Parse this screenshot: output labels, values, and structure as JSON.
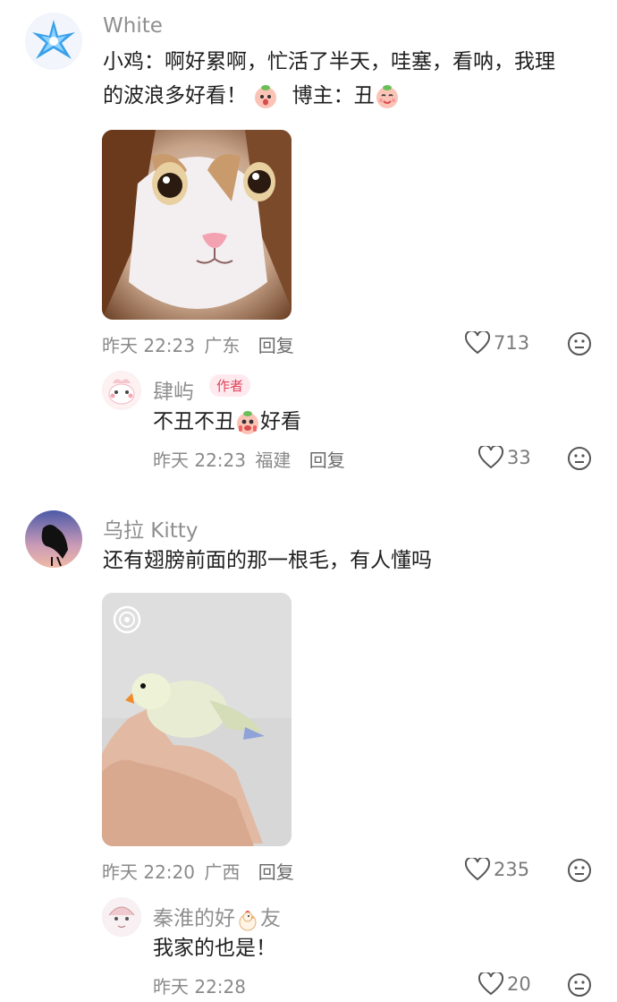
{
  "comments": [
    {
      "username": "White",
      "text_line1": "小鸡：啊好累啊，忙活了半天，哇塞，看呐，我理",
      "text_line2_a": "的波浪多好看！",
      "text_line2_b": "博主：丑",
      "time": "昨天 22:23",
      "location": "广东",
      "reply_label": "回复",
      "likes": "713",
      "replies": [
        {
          "username": "肆屿",
          "badge": "作者",
          "text_a": "不丑不丑",
          "text_b": "好看",
          "time": "昨天 22:23",
          "location": "福建",
          "reply_label": "回复",
          "likes": "33"
        }
      ]
    },
    {
      "username": "乌拉 Kitty",
      "text": "还有翅膀前面的那一根毛，有人懂吗",
      "time": "昨天 22:20",
      "location": "广西",
      "reply_label": "回复",
      "likes": "235",
      "replies": [
        {
          "username_a": "秦淮的好",
          "username_b": "友",
          "text": "我家的也是！",
          "time": "昨天 22:28",
          "likes": "20"
        }
      ]
    }
  ],
  "colors": {
    "badge_bg": "#fde9ee",
    "badge_text": "#e0455a",
    "meta": "#8a8a8a"
  }
}
